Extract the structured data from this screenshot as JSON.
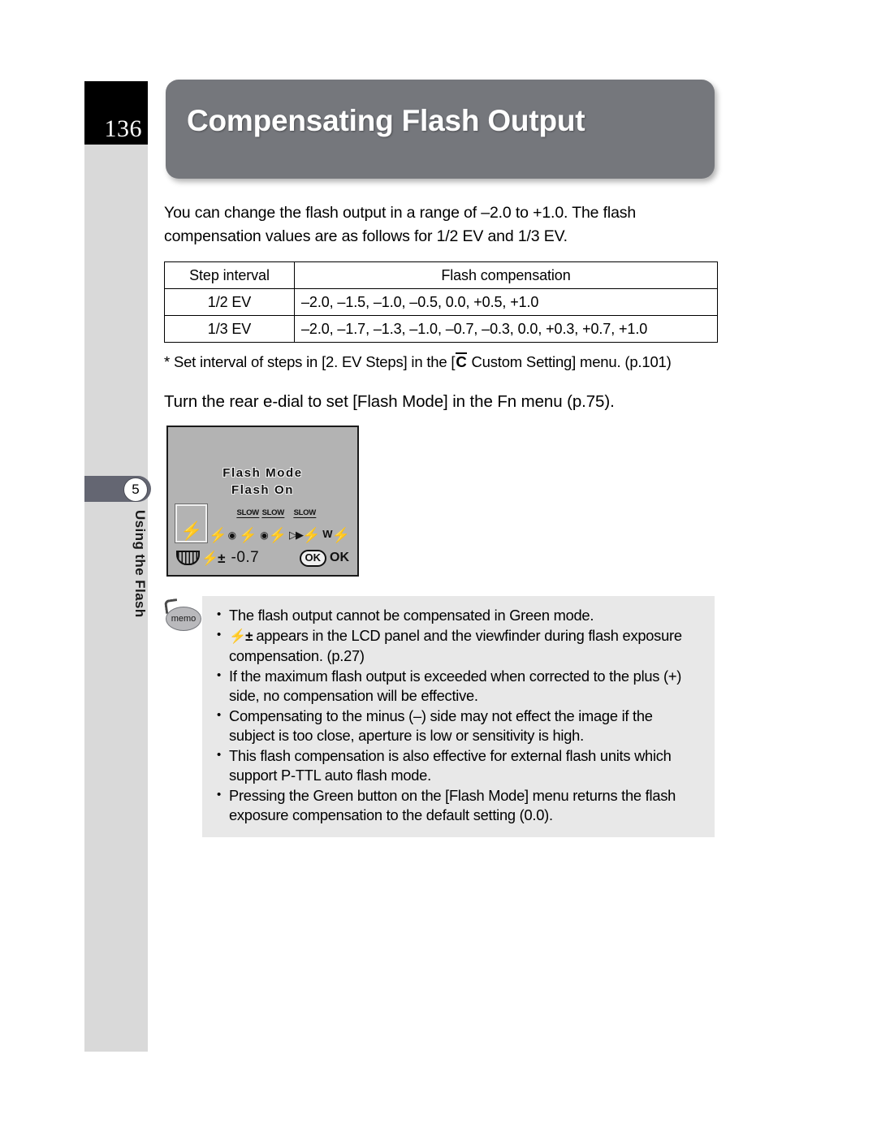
{
  "page": {
    "number": "136",
    "chapter_number": "5",
    "chapter_title": "Using the Flash"
  },
  "header": {
    "title": "Compensating Flash Output"
  },
  "intro": {
    "paragraph": "You can change the flash output in a range of –2.0 to +1.0. The flash compensation values are as follows for 1/2 EV and 1/3 EV."
  },
  "table": {
    "headers": [
      "Step interval",
      "Flash compensation"
    ],
    "rows": [
      {
        "step": "1/2 EV",
        "compensation": "–2.0, –1.5, –1.0, –0.5, 0.0, +0.5, +1.0"
      },
      {
        "step": "1/3 EV",
        "compensation": "–2.0, –1.7, –1.3, –1.0, –0.7, –0.3, 0.0, +0.3, +0.7, +1.0"
      }
    ]
  },
  "footnote": {
    "prefix": "*  Set interval of steps in [2. EV Steps] in the [",
    "symbol": "C",
    "suffix": " Custom Setting] menu. (p.101)"
  },
  "instruction": {
    "text": "Turn the rear e-dial to set [Flash Mode] in the Fn menu (p.75)."
  },
  "lcd": {
    "title": "Flash Mode",
    "subtitle": "Flash On",
    "modes": [
      {
        "name": "flash-on-icon",
        "slow": "",
        "selected": true,
        "bolt": "⚡",
        "extra": ""
      },
      {
        "name": "red-eye-reduction-icon",
        "slow": "",
        "selected": false,
        "bolt": "⚡",
        "extra": "◉"
      },
      {
        "name": "slow-sync-icon",
        "slow": "SLOW",
        "selected": false,
        "bolt": "⚡",
        "extra": ""
      },
      {
        "name": "slow-sync-red-eye-icon",
        "slow": "SLOW",
        "selected": false,
        "bolt": "⚡",
        "extra": "◉"
      },
      {
        "name": "trailing-curtain-sync-icon",
        "slow": "SLOW",
        "selected": false,
        "bolt": "⚡",
        "extra": "▶"
      },
      {
        "name": "wireless-flash-icon",
        "slow": "",
        "selected": false,
        "bolt": "⚡",
        "extra": "W"
      }
    ],
    "compensation_value": "-0.7",
    "ok_badge": "OK",
    "ok_label": "OK"
  },
  "memo": {
    "icon_label": "memo",
    "bullets": [
      "The flash output cannot be compensated in Green mode.",
      "appears in the LCD panel and the viewfinder during flash exposure compensation. (p.27)",
      "If the maximum flash output is exceeded when corrected to the plus (+) side, no compensation will be effective.",
      "Compensating to the minus (–) side may not effect the image if the subject is too close, aperture is low or sensitivity is high.",
      "This flash compensation is also effective for external flash units which support P-TTL auto flash mode.",
      "Pressing the Green button on the [Flash Mode] menu returns the flash exposure compensation to the default setting (0.0)."
    ]
  }
}
